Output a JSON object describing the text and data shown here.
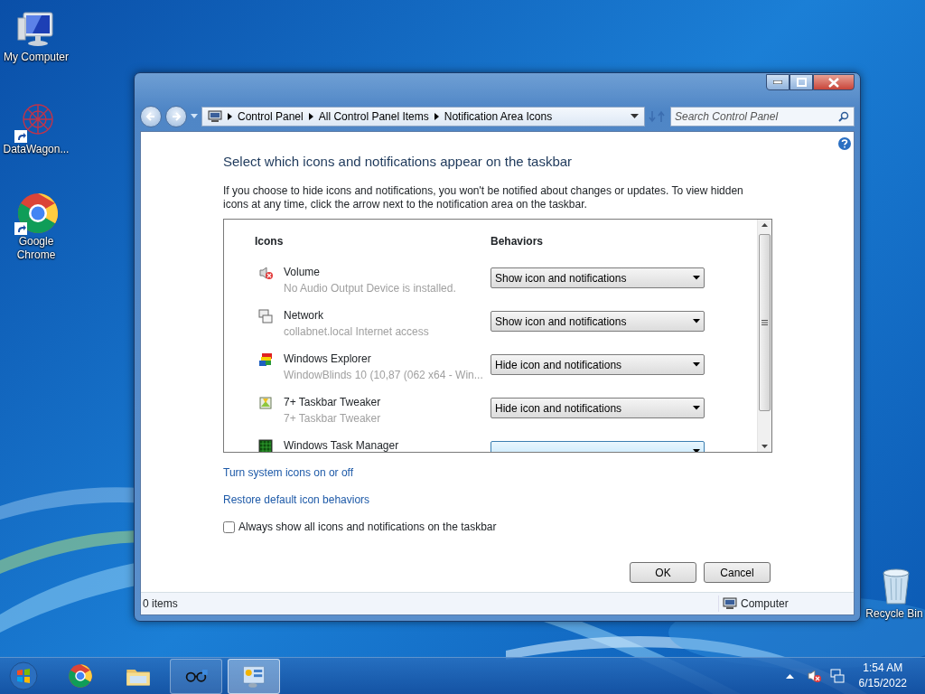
{
  "desktop_icons": [
    {
      "label": "My Computer",
      "kind": "computer",
      "shortcut": false
    },
    {
      "label": "DataWagon...",
      "kind": "datawagon",
      "shortcut": true
    },
    {
      "label": "Google Chrome",
      "kind": "chrome",
      "shortcut": true
    },
    {
      "label": "Recycle Bin",
      "kind": "recycle",
      "shortcut": false
    }
  ],
  "window": {
    "breadcrumb": [
      "Control Panel",
      "All Control Panel Items",
      "Notification Area Icons"
    ],
    "search": {
      "placeholder": "Search Control Panel"
    },
    "heading": "Select which icons and notifications appear on the taskbar",
    "description": "If you choose to hide icons and notifications, you won't be notified about changes or updates. To view hidden icons at any time, click the arrow next to the notification area on the taskbar.",
    "columns": [
      "Icons",
      "Behaviors"
    ],
    "rows": [
      {
        "kind": "volume",
        "name": "Volume",
        "detail": "No Audio Output Device is installed.",
        "behavior": "Show icon and notifications"
      },
      {
        "kind": "network",
        "name": "Network",
        "detail": "collabnet.local Internet access",
        "behavior": "Show icon and notifications"
      },
      {
        "kind": "explorer",
        "name": "Windows Explorer",
        "detail": "WindowBlinds 10 (10,87 (062 x64 - Win...",
        "behavior": "Hide icon and notifications"
      },
      {
        "kind": "tweaker",
        "name": "7+ Taskbar Tweaker",
        "detail": "7+ Taskbar Tweaker",
        "behavior": "Hide icon and notifications"
      },
      {
        "kind": "taskmgr",
        "name": "Windows Task Manager"
      }
    ],
    "links": [
      "Turn system icons on or off",
      "Restore default icon behaviors"
    ],
    "checkbox": {
      "label": "Always show all icons and notifications on the taskbar",
      "checked": false
    },
    "buttons": [
      "OK",
      "Cancel"
    ],
    "status_bar": {
      "items": "0 items",
      "location": "Computer"
    }
  },
  "taskbar": {
    "apps": [
      {
        "kind": "chrome",
        "running": false,
        "selected": false
      },
      {
        "kind": "folder",
        "running": false,
        "selected": false
      },
      {
        "kind": "glasses",
        "running": true,
        "selected": false
      },
      {
        "kind": "control-panel",
        "running": true,
        "selected": true
      }
    ],
    "clock": {
      "time": "1:54 AM",
      "date": "6/15/2022"
    }
  }
}
